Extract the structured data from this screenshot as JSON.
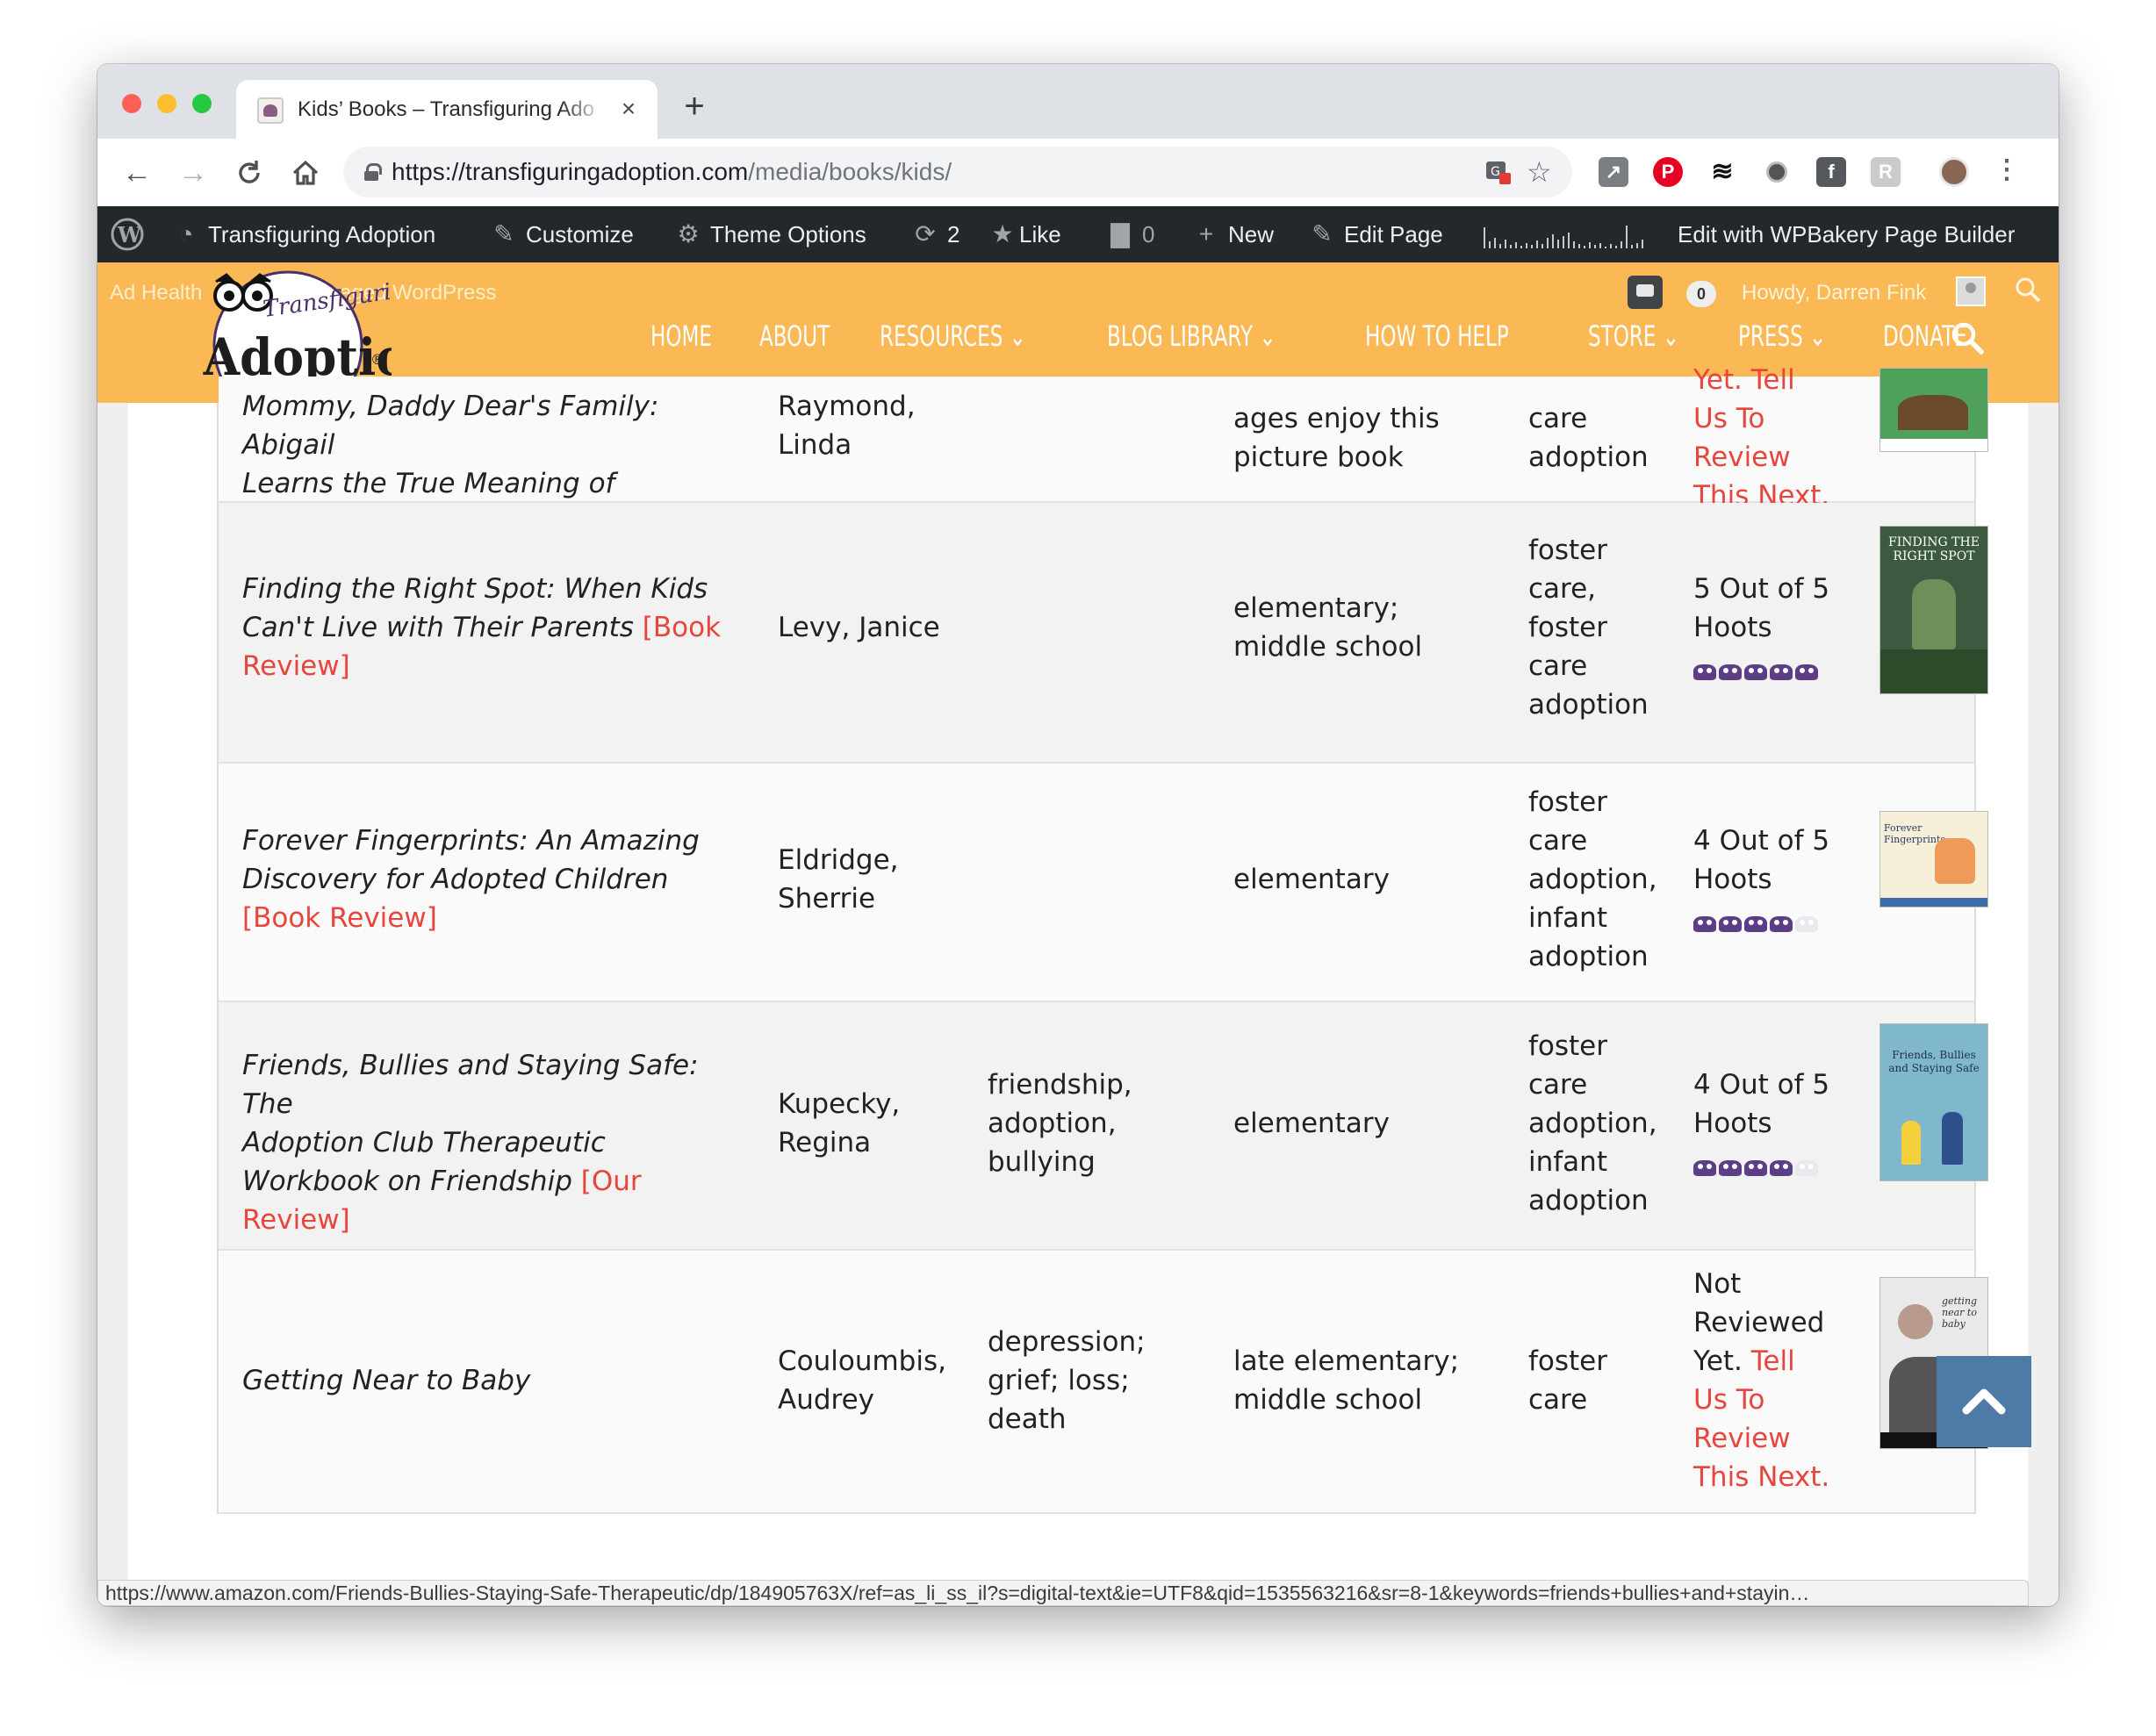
{
  "browser": {
    "tab_title": "Kids’ Books – Transfiguring Ado",
    "tab_close": "×",
    "new_tab": "+",
    "url_host": "https://transfiguringadoption.com",
    "url_path": "/media/books/kids/",
    "status_url": "https://www.amazon.com/Friends-Bullies-Staying-Safe-Therapeutic/dp/184905763X/ref=as_li_ss_il?s=digital-text&ie=UTF8&qid=1535563216&sr=8-1&keywords=friends+bullies+and+stayin…"
  },
  "adminbar": {
    "site_name": "Transfiguring Adoption",
    "customize": "Customize",
    "theme_options": "Theme Options",
    "updates_count": "2",
    "like": "Like",
    "comments_count": "0",
    "new": "New",
    "edit_page": "Edit Page",
    "wpbakery": "Edit with WPBakery Page Builder"
  },
  "topbar": {
    "ad_health": "Ad Health",
    "managed": "Managed WordPress",
    "notif_count": "0",
    "howdy": "Howdy, Darren Fink"
  },
  "logo": {
    "line1": "Transfiguring",
    "line2": "Adoption"
  },
  "nav": {
    "home": "HOME",
    "about": "ABOUT",
    "resources": "RESOURCES ⌄",
    "blog_library": "BLOG LIBRARY ⌄",
    "how_to_help": "HOW TO HELP",
    "store": "STORE ⌄",
    "press": "PRESS ⌄",
    "donate": "DONATE"
  },
  "rows": [
    {
      "title_lines": [
        "Mommy, Daddy Dear's Family: Abigail",
        "Learns the True Meaning of Adoption"
      ],
      "author_lines": [
        "Raymond,",
        "Linda"
      ],
      "topics": [],
      "age_lines": [
        "ages enjoy this",
        "picture book"
      ],
      "type_lines": [
        "care",
        "adoption"
      ],
      "review_lines": [
        "Yet. Tell",
        "Us To",
        "Review",
        "This Next."
      ],
      "stars": 0
    },
    {
      "title_lines": [
        "Finding the Right Spot: When Kids",
        "Can't Live with Their Parents"
      ],
      "link_lines": [
        "[Book",
        "Review]"
      ],
      "author_lines": [
        "Levy, Janice"
      ],
      "age_lines": [
        "elementary;",
        "middle school"
      ],
      "type_lines": [
        "foster",
        "care,",
        "foster",
        "care",
        "adoption"
      ],
      "review_lines": [
        "5 Out of 5",
        "Hoots"
      ],
      "stars": 5,
      "cover_title": "FINDING THE RIGHT SPOT"
    },
    {
      "title_lines": [
        "Forever Fingerprints: An Amazing",
        "Discovery for Adopted Children"
      ],
      "link_lines": [
        "[Book Review]"
      ],
      "author_lines": [
        "Eldridge,",
        "Sherrie"
      ],
      "age_lines": [
        "elementary"
      ],
      "type_lines": [
        "foster",
        "care",
        "adoption,",
        "infant",
        "adoption"
      ],
      "review_lines": [
        "4 Out of 5",
        "Hoots"
      ],
      "stars": 4,
      "cover_title": "Forever Fingerprints"
    },
    {
      "title_lines": [
        "Friends, Bullies and Staying Safe: The",
        "Adoption Club Therapeutic",
        "Workbook on Friendship"
      ],
      "link_lines": [
        "[Our",
        "Review]"
      ],
      "author_lines": [
        "Kupecky,",
        "Regina"
      ],
      "topic_lines": [
        "friendship,",
        "adoption,",
        "bullying"
      ],
      "age_lines": [
        "elementary"
      ],
      "type_lines": [
        "foster",
        "care",
        "adoption,",
        "infant",
        "adoption"
      ],
      "review_lines": [
        "4 Out of 5",
        "Hoots"
      ],
      "stars": 4,
      "cover_title": "Friends, Bullies and Staying Safe"
    },
    {
      "title_lines": [
        "Getting Near to Baby"
      ],
      "author_lines": [
        "Couloumbis,",
        "Audrey"
      ],
      "topic_lines": [
        "depression;",
        "grief; loss;",
        "death"
      ],
      "age_lines": [
        "late elementary;",
        "middle school"
      ],
      "type_lines": [
        "foster",
        "care"
      ],
      "review_lines": [
        "Not",
        "Reviewed",
        "Yet. Tell",
        "Us To",
        "Review",
        "This Next."
      ],
      "stars": 0,
      "cover_title": "getting near to baby"
    }
  ],
  "colors": {
    "accent": "#fbb955",
    "link": "#e8453c",
    "owl": "#5b3e86",
    "adminbar": "#23282d",
    "totop": "#4d7ba5"
  }
}
